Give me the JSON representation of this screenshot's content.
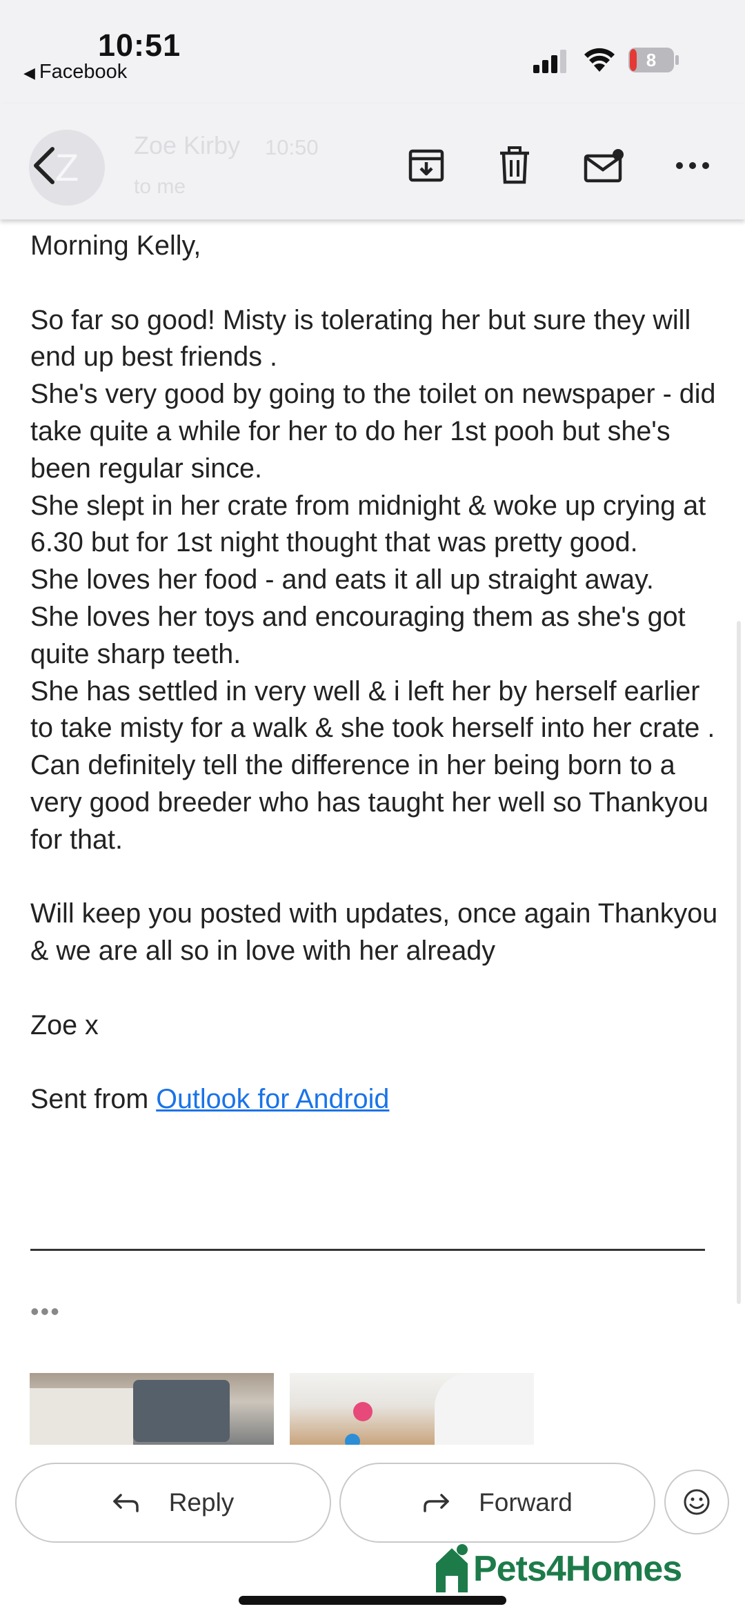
{
  "status_bar": {
    "time": "10:51",
    "back_app": "Facebook",
    "battery_level": "8",
    "icons": [
      "signal-icon",
      "wifi-icon",
      "battery-icon"
    ]
  },
  "header": {
    "sender": "Zoe Kirby",
    "time": "10:50",
    "recipient": "to me",
    "avatar_initial": "Z",
    "icons": [
      "back-icon",
      "archive-icon",
      "trash-icon",
      "mark-unread-icon",
      "more-icon"
    ]
  },
  "email": {
    "greeting": "Morning Kelly,",
    "paragraph1": "So far so good! Misty is tolerating her but sure they will end up best friends .\nShe's very good by going to the toilet on newspaper - did take quite a while for her to do her 1st pooh but she's been regular since.\nShe slept in her crate from midnight & woke up crying at 6.30 but for 1st night thought that was pretty good.\nShe loves her food - and eats it all up straight away.\nShe loves her toys and encouraging them as she's got quite sharp teeth.\nShe has settled in very well & i left her by herself earlier to take misty for a walk & she took herself into her crate .\nCan definitely tell the difference in her being born to a very good breeder who has taught her well so Thankyou for that.",
    "paragraph2": "Will keep you posted with updates, once again Thankyou & we are all so in love with her already",
    "signoff": "Zoe x",
    "sent_from_prefix": "Sent from ",
    "sent_from_link": "Outlook for Android",
    "trimmed_indicator": "•••"
  },
  "actions": {
    "reply_label": "Reply",
    "forward_label": "Forward"
  },
  "watermark": {
    "brand": "Pets4Homes"
  },
  "colors": {
    "link": "#1a73e8",
    "brand_green": "#1d7b4a",
    "battery_red": "#e53935"
  }
}
